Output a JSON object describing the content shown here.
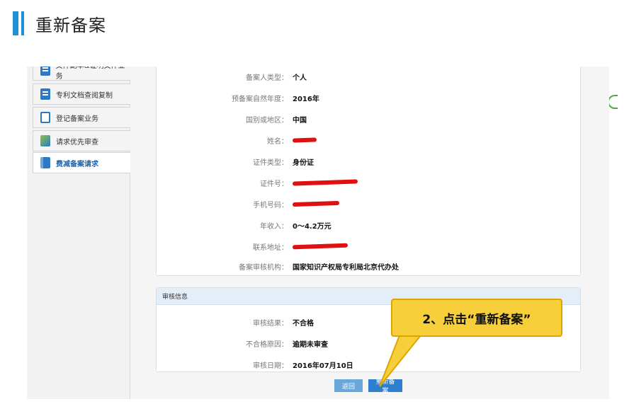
{
  "page_title": "重新备案",
  "sidebar": {
    "items": [
      {
        "label": "文件副本&证明文件业务",
        "icon": "document-icon"
      },
      {
        "label": "专利文档查阅复制",
        "icon": "document-icon"
      },
      {
        "label": "登记备案业务",
        "icon": "register-icon"
      },
      {
        "label": "请求优先审查",
        "icon": "priority-icon"
      },
      {
        "label": "费减备案请求",
        "icon": "fee-icon",
        "active": true
      }
    ]
  },
  "filing_info": {
    "rows": [
      {
        "label": "备案人类型：",
        "value": "个人"
      },
      {
        "label": "预备案自然年度：",
        "value": "2016年"
      },
      {
        "label": "国别或地区：",
        "value": "中国"
      },
      {
        "label": "姓名：",
        "value": ""
      },
      {
        "label": "证件类型：",
        "value": "身份证"
      },
      {
        "label": "证件号：",
        "value": ""
      },
      {
        "label": "手机号码：",
        "value": ""
      },
      {
        "label": "年收入：",
        "value": "0～4.2万元"
      },
      {
        "label": "联系地址：",
        "value": ""
      },
      {
        "label": "备案审核机构：",
        "value": "国家知识产权局专利局北京代办处"
      }
    ]
  },
  "review": {
    "header": "审核信息",
    "rows": [
      {
        "label": "审核结果：",
        "value": "不合格"
      },
      {
        "label": "不合格原因：",
        "value": "逾期未审查"
      },
      {
        "label": "审核日期：",
        "value": "2016年07月10日"
      }
    ]
  },
  "buttons": {
    "back_label": "返回",
    "refile_label": "重新备案"
  },
  "callout": {
    "text": "2、点击“重新备案”"
  },
  "colors": {
    "accent": "#1f8fd6",
    "callout": "#f7cf3a",
    "redaction": "#e01010"
  }
}
